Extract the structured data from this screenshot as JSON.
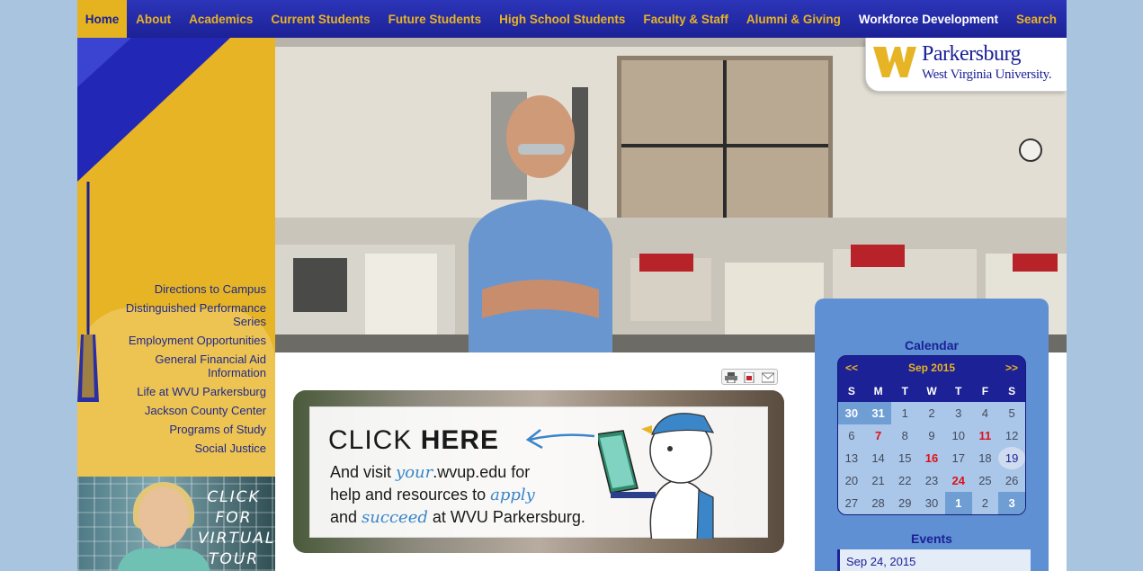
{
  "nav": {
    "items": [
      {
        "label": "Home"
      },
      {
        "label": "About"
      },
      {
        "label": "Academics"
      },
      {
        "label": "Current Students"
      },
      {
        "label": "Future Students"
      },
      {
        "label": "High School Students"
      },
      {
        "label": "Faculty & Staff"
      },
      {
        "label": "Alumni & Giving"
      },
      {
        "label": "Workforce Development"
      }
    ],
    "search_label": "Search"
  },
  "logo": {
    "name": "Parkersburg",
    "sub": "West Virginia University."
  },
  "quick_links": [
    "Directions to Campus",
    "Distinguished Performance Series",
    "Employment Opportunities",
    "General Financial Aid Information",
    "Life at WVU Parkersburg",
    "Jackson County Center",
    "Programs of Study",
    "Social Justice"
  ],
  "virtual_tour": {
    "text": "CLICK FOR VIRTUAL TOUR"
  },
  "banner": {
    "headline_1": "CLICK ",
    "headline_2": "HERE",
    "line1_a": "And visit ",
    "line1_b": "your",
    "line1_c": ".wvup.edu for",
    "line2_a": "help and resources to ",
    "line2_b": "apply",
    "line3_a": "and ",
    "line3_b": "succeed",
    "line3_c": " at WVU Parkersburg."
  },
  "calendar": {
    "title": "Calendar",
    "prev": "<<",
    "next": ">>",
    "month": "Sep 2015",
    "weekdays": [
      "S",
      "M",
      "T",
      "W",
      "T",
      "F",
      "S"
    ],
    "weeks": [
      [
        "30",
        "31",
        "1",
        "2",
        "3",
        "4",
        "5"
      ],
      [
        "6",
        "7",
        "8",
        "9",
        "10",
        "11",
        "12"
      ],
      [
        "13",
        "14",
        "15",
        "16",
        "17",
        "18",
        "19"
      ],
      [
        "20",
        "21",
        "22",
        "23",
        "24",
        "25",
        "26"
      ],
      [
        "27",
        "28",
        "29",
        "30",
        "1",
        "2",
        "3"
      ]
    ]
  },
  "events": {
    "title": "Events",
    "items": [
      "Sep 24, 2015"
    ]
  },
  "colors": {
    "nav_blue": "#1c2196",
    "gold": "#e6b424",
    "event_red": "#e0101a",
    "panel_blue": "#5f90d3"
  }
}
